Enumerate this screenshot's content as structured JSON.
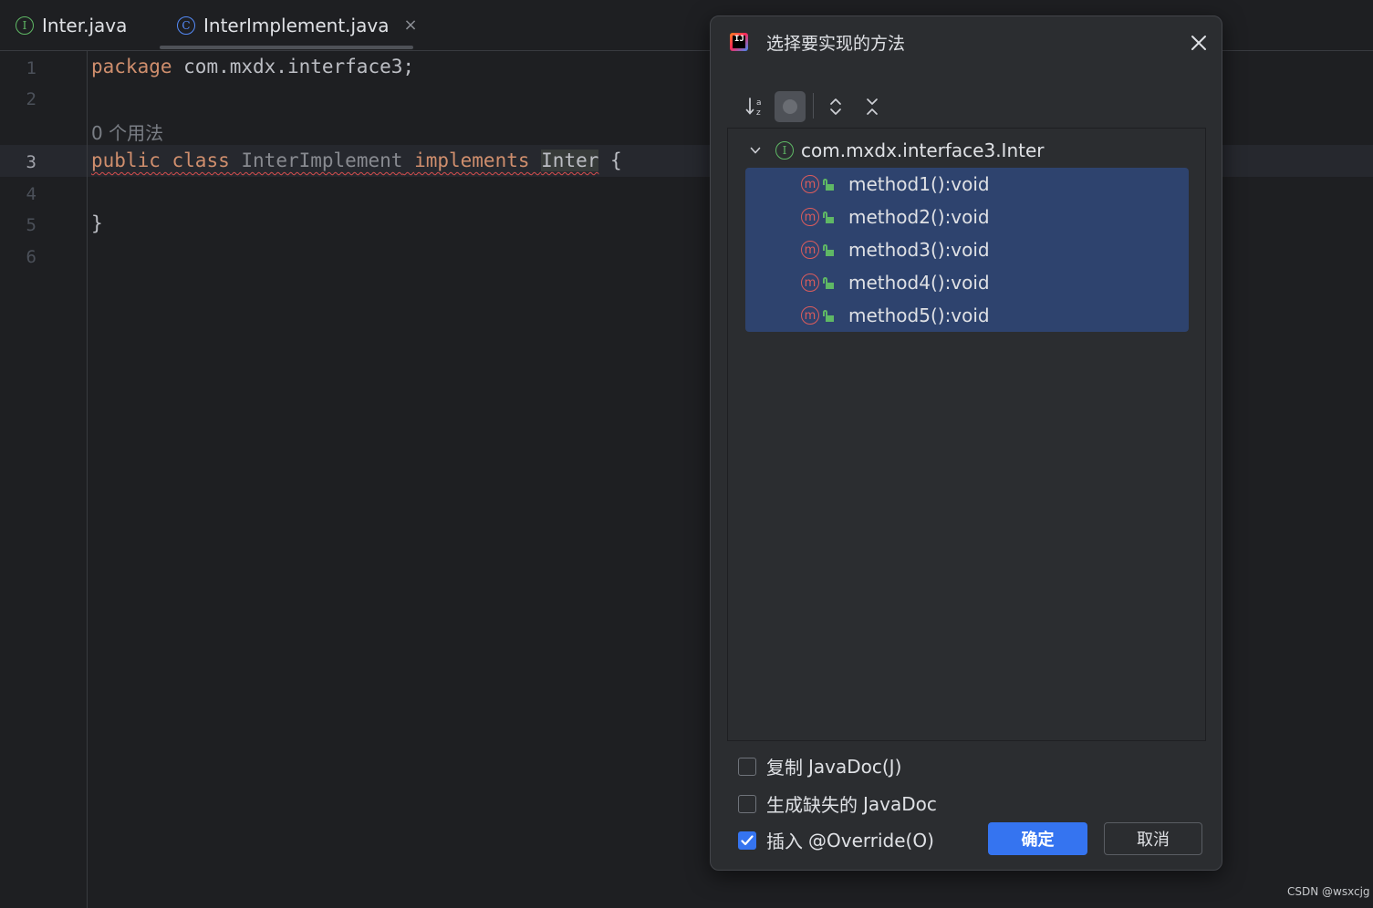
{
  "tabs": [
    {
      "icon": "interface-icon",
      "glyph": "I",
      "label": "Inter.java"
    },
    {
      "icon": "class-icon",
      "glyph": "C",
      "label": "InterImplement.java",
      "close": "×"
    }
  ],
  "editor": {
    "line_numbers": [
      "1",
      "2",
      "3",
      "4",
      "5",
      "6"
    ],
    "line1": {
      "kw": "package",
      "rest": " com.mxdx.interface3;"
    },
    "usage_hint": "0 个用法",
    "line3": {
      "kw1": "public",
      "kw2": "class",
      "cls": "InterImplement",
      "kw3": "implements",
      "iface": "Inter",
      "brace": " {"
    },
    "line5": "}"
  },
  "dialog": {
    "title": "选择要实现的方法",
    "tree_root": "com.mxdx.interface3.Inter",
    "root_glyph": "I",
    "method_glyph": "m",
    "methods": [
      "method1():void",
      "method2():void",
      "method3():void",
      "method4():void",
      "method5():void"
    ],
    "options": [
      {
        "cn": "复制",
        "en": "JavaDoc(J)",
        "checked": false
      },
      {
        "cn": "生成缺失的",
        "en": "JavaDoc",
        "checked": false
      },
      {
        "cn": "插入",
        "en": "@Override(O)",
        "checked": true
      }
    ],
    "ok_label": "确定",
    "cancel_label": "取消",
    "sort_icon_glyph": "↓ª"
  },
  "watermark": "CSDN @wsxcjg",
  "colors": {
    "accent": "#3574f0",
    "selection": "#2e436e",
    "keyword": "#cf8e6d",
    "error_underline": "#d94e4e"
  }
}
